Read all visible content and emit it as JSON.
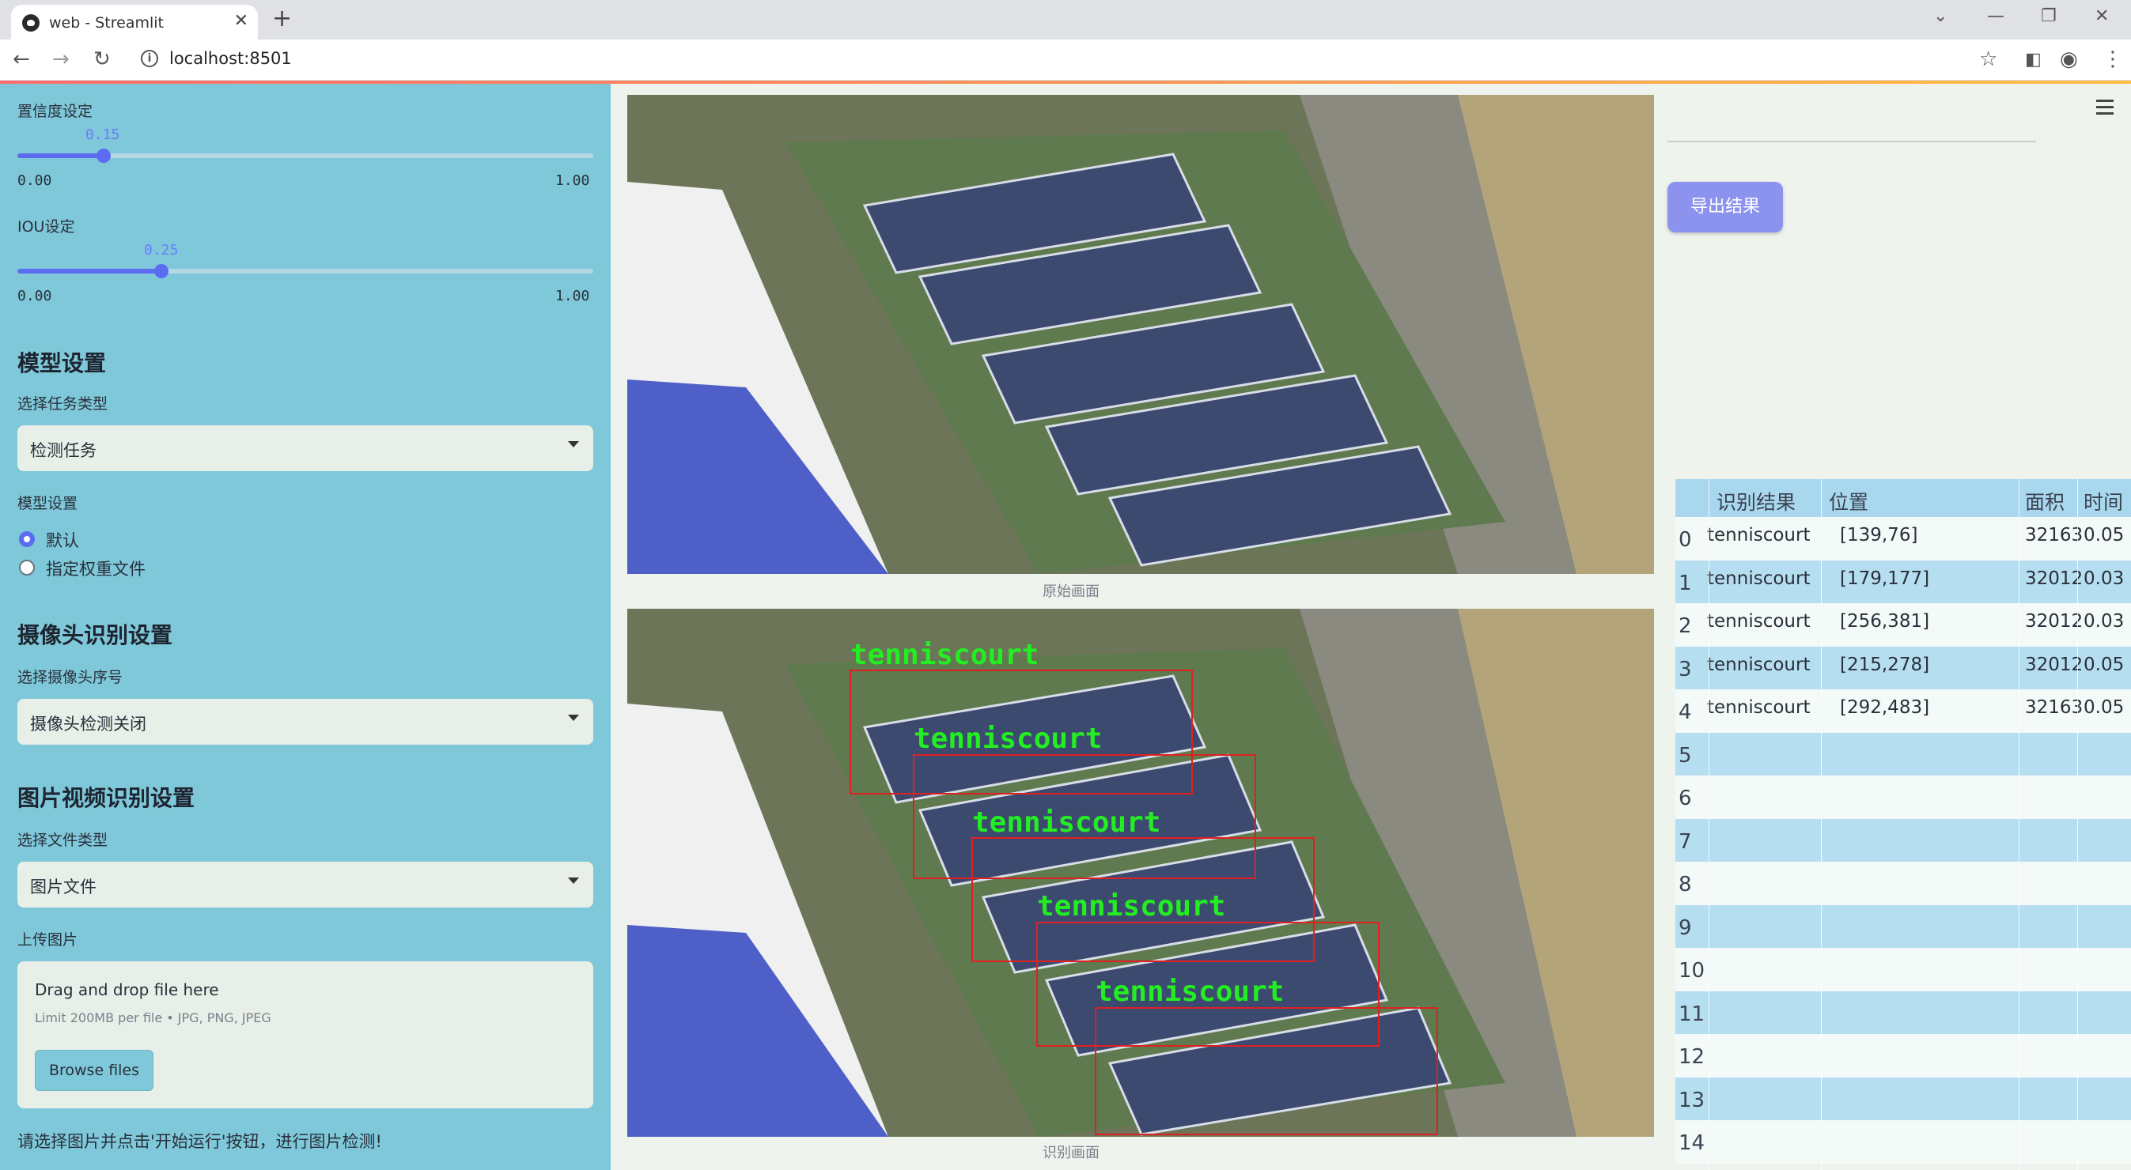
{
  "browser": {
    "tab_title": "web - Streamlit",
    "url": "localhost:8501"
  },
  "sidebar": {
    "confidence": {
      "label": "置信度设定",
      "value": "0.15",
      "fraction": 0.15,
      "min": "0.00",
      "max": "1.00"
    },
    "iou": {
      "label": "IOU设定",
      "value": "0.25",
      "fraction": 0.25,
      "min": "0.00",
      "max": "1.00"
    },
    "model_heading": "模型设置",
    "task_label": "选择任务类型",
    "task_value": "检测任务",
    "model_label": "模型设置",
    "radio_default": "默认",
    "radio_custom": "指定权重文件",
    "camera_heading": "摄像头识别设置",
    "camera_label": "选择摄像头序号",
    "camera_value": "摄像头检测关闭",
    "media_heading": "图片视频识别设置",
    "filetype_label": "选择文件类型",
    "filetype_value": "图片文件",
    "upload_label": "上传图片",
    "upload_title": "Drag and drop file here",
    "upload_hint": "Limit 200MB per file • JPG, PNG, JPEG",
    "browse_label": "Browse files",
    "footer_note": "请选择图片并点击'开始运行'按钮，进行图片检测!"
  },
  "images": {
    "original_caption": "原始画面",
    "result_caption": "识别画面",
    "detection_label": "tenniscourt"
  },
  "results": {
    "export_label": "导出结果",
    "columns": [
      "",
      "识别结果",
      "位置",
      "面积",
      "时间"
    ],
    "rows": [
      {
        "idx": "0",
        "name": "tenniscourt",
        "pos": "[139,76]",
        "area": "32163",
        "time": "0.05"
      },
      {
        "idx": "1",
        "name": "tenniscourt",
        "pos": "[179,177]",
        "area": "32012",
        "time": "0.03"
      },
      {
        "idx": "2",
        "name": "tenniscourt",
        "pos": "[256,381]",
        "area": "32012",
        "time": "0.03"
      },
      {
        "idx": "3",
        "name": "tenniscourt",
        "pos": "[215,278]",
        "area": "32012",
        "time": "0.05"
      },
      {
        "idx": "4",
        "name": "tenniscourt",
        "pos": "[292,483]",
        "area": "32163",
        "time": "0.05"
      },
      {
        "idx": "5"
      },
      {
        "idx": "6"
      },
      {
        "idx": "7"
      },
      {
        "idx": "8"
      },
      {
        "idx": "9"
      },
      {
        "idx": "10"
      },
      {
        "idx": "11"
      },
      {
        "idx": "12"
      },
      {
        "idx": "13"
      },
      {
        "idx": "14"
      }
    ]
  },
  "colors": {
    "sidebar_bg": "#7ec8da",
    "accent": "#5b6cf0",
    "export_button": "#8b93ee",
    "detection_box": "#e02020",
    "detection_text": "#22ee22"
  }
}
